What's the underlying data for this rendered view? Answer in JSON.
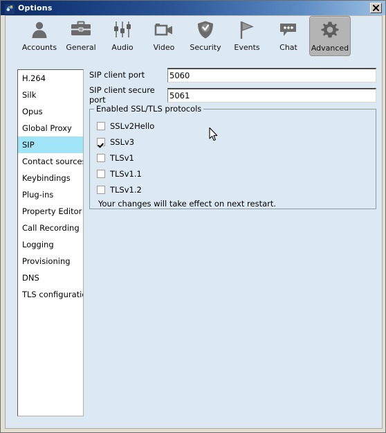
{
  "window": {
    "title": "Options",
    "title_icon": "app-icon",
    "close_label": "close-icon"
  },
  "toolbar": {
    "items": [
      {
        "label": "Accounts",
        "icon": "person-icon",
        "selected": false
      },
      {
        "label": "General",
        "icon": "briefcase-icon",
        "selected": false
      },
      {
        "label": "Audio",
        "icon": "sliders-icon",
        "selected": false
      },
      {
        "label": "Video",
        "icon": "camera-icon",
        "selected": false
      },
      {
        "label": "Security",
        "icon": "shield-icon",
        "selected": false
      },
      {
        "label": "Events",
        "icon": "flag-icon",
        "selected": false
      },
      {
        "label": "Chat",
        "icon": "speech-bubble-icon",
        "selected": false
      },
      {
        "label": "Advanced",
        "icon": "gear-icon",
        "selected": true
      }
    ]
  },
  "sidebar": {
    "items": [
      {
        "label": "H.264",
        "selected": false
      },
      {
        "label": "Silk",
        "selected": false
      },
      {
        "label": "Opus",
        "selected": false
      },
      {
        "label": "Global Proxy",
        "selected": false
      },
      {
        "label": "SIP",
        "selected": true
      },
      {
        "label": "Contact sources",
        "selected": false
      },
      {
        "label": "Keybindings",
        "selected": false
      },
      {
        "label": "Plug-ins",
        "selected": false
      },
      {
        "label": "Property Editor",
        "selected": false
      },
      {
        "label": "Call Recording",
        "selected": false
      },
      {
        "label": "Logging",
        "selected": false
      },
      {
        "label": "Provisioning",
        "selected": false
      },
      {
        "label": "DNS",
        "selected": false
      },
      {
        "label": "TLS configuration",
        "selected": false
      }
    ]
  },
  "panel": {
    "fields": [
      {
        "label": "SIP client port",
        "value": "5060"
      },
      {
        "label": "SIP client secure port",
        "value": "5061"
      }
    ],
    "group": {
      "legend": "Enabled SSL/TLS protocols",
      "checkboxes": [
        {
          "label": "SSLv2Hello",
          "checked": false
        },
        {
          "label": "SSLv3",
          "checked": true
        },
        {
          "label": "TLSv1",
          "checked": false
        },
        {
          "label": "TLSv1.1",
          "checked": false
        },
        {
          "label": "TLSv1.2",
          "checked": false
        }
      ],
      "note": "Your changes will take effect on next restart."
    }
  },
  "colors": {
    "panel_background": "#dce9f2",
    "selection_highlight": "#9fe5f7",
    "titlebar_start": "#0a2a64",
    "titlebar_end": "#9fc2e3",
    "frame": "#e3dfd2"
  }
}
